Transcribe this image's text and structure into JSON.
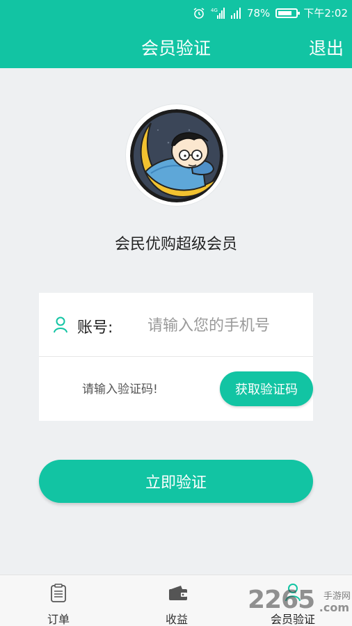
{
  "status_bar": {
    "battery": "78%",
    "time": "下午2:02",
    "network": "4G",
    "battery_level": 0.78
  },
  "header": {
    "title": "会员验证",
    "logout_label": "退出"
  },
  "profile": {
    "member_name": "会民优购超级会员"
  },
  "form": {
    "account_label": "账号:",
    "phone_placeholder": "请输入您的手机号",
    "code_placeholder": "请输入验证码!",
    "get_code_label": "获取验证码"
  },
  "verify_button_label": "立即验证",
  "bottom_nav": [
    {
      "label": "订单",
      "icon": "orders-icon"
    },
    {
      "label": "收益",
      "icon": "wallet-icon"
    },
    {
      "label": "会员验证",
      "icon": "user-icon"
    }
  ],
  "watermark": {
    "number": "2265",
    "site": "手游网",
    "domain": ".com"
  },
  "colors": {
    "accent": "#12c4a3",
    "background": "#eef0f2"
  }
}
